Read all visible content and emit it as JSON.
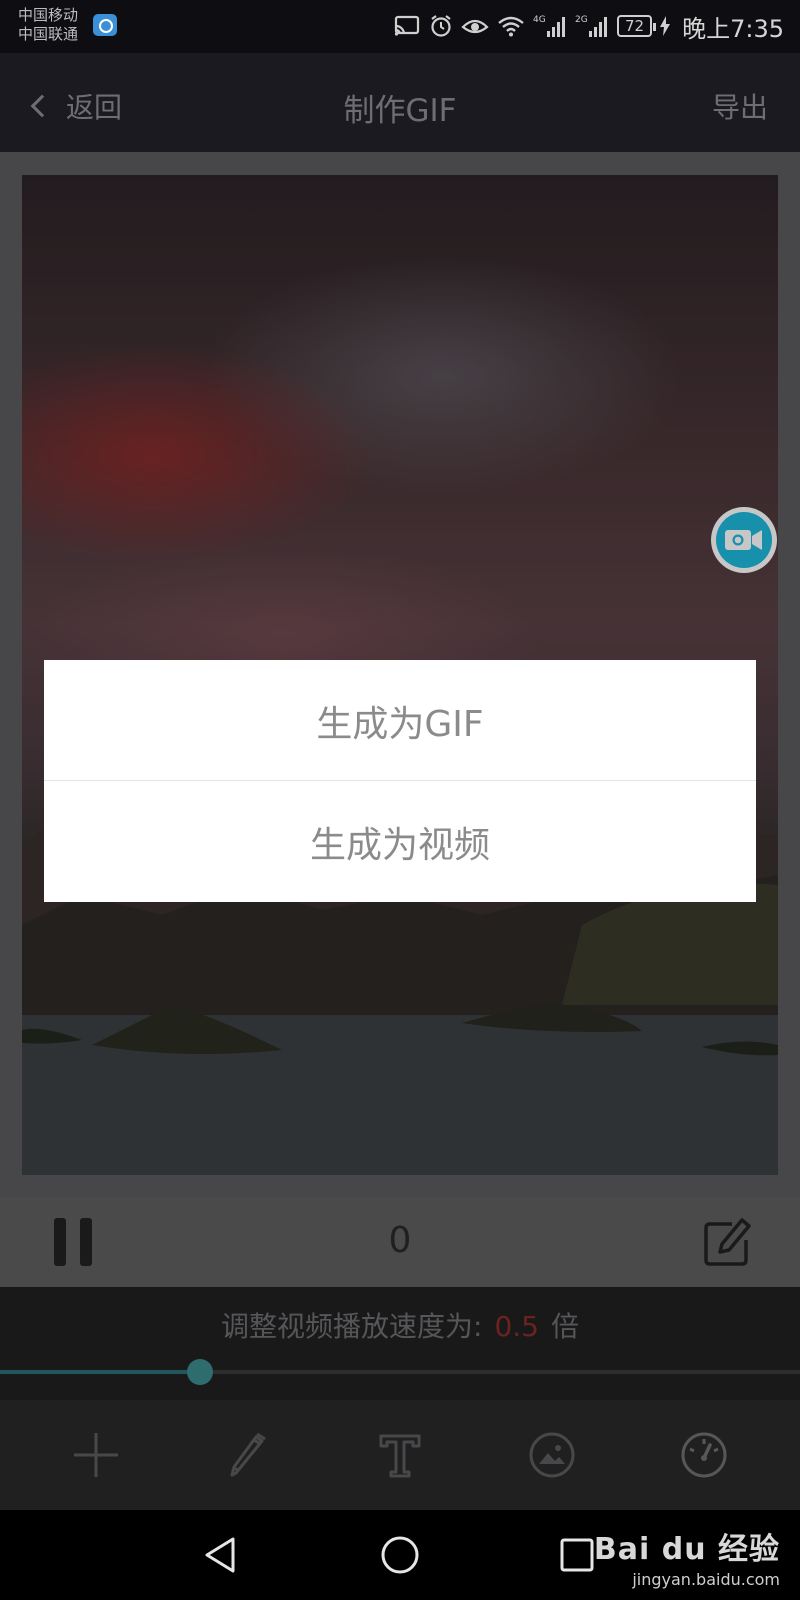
{
  "status_bar": {
    "carrier_1": "中国移动",
    "carrier_2": "中国联通",
    "network_1": "4G",
    "network_2": "2G",
    "battery": "72",
    "time": "晚上7:35"
  },
  "header": {
    "back_label": "返回",
    "title": "制作GIF",
    "export_label": "导出"
  },
  "dialog": {
    "options": [
      {
        "label": "生成为GIF"
      },
      {
        "label": "生成为视频"
      }
    ]
  },
  "playback": {
    "frame_counter": "0"
  },
  "speed": {
    "label": "调整视频播放速度为:",
    "value": "0.5",
    "unit": "倍",
    "slider_fraction": 0.25
  },
  "toolbar": {
    "tools": [
      "add-icon",
      "pencil-icon",
      "text-icon",
      "image-icon",
      "speed-gauge-icon"
    ]
  },
  "watermark": {
    "logo": "Bai du 经验",
    "url": "jingyan.baidu.com"
  },
  "colors": {
    "accent": "#1db9dc",
    "speed_value": "#8a2d26",
    "slider": "#3b8b90"
  }
}
